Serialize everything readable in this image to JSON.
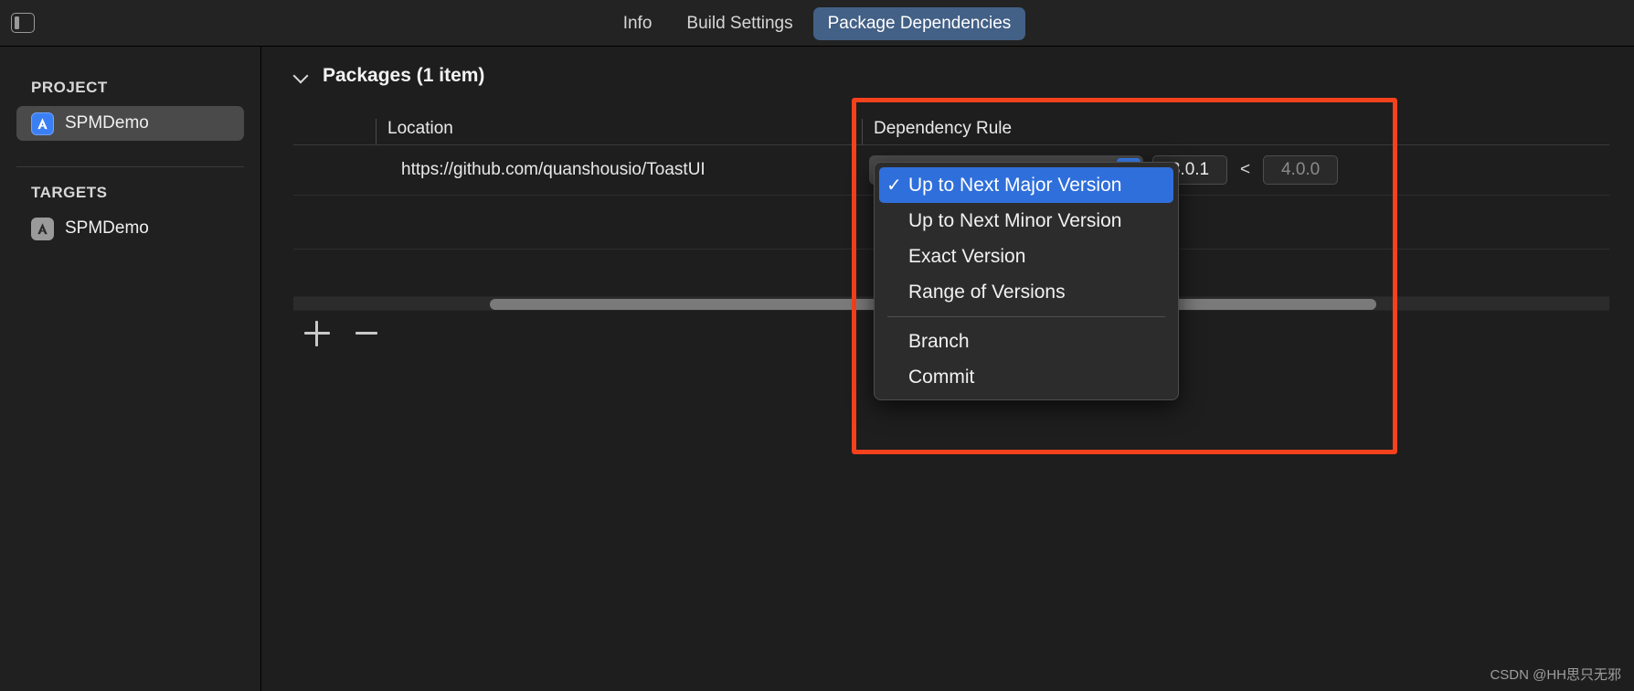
{
  "window": {
    "sidebar_toggle_icon": "sidebar-toggle-icon"
  },
  "tabs": [
    {
      "label": "Info",
      "selected": false
    },
    {
      "label": "Build Settings",
      "selected": false
    },
    {
      "label": "Package Dependencies",
      "selected": true
    }
  ],
  "sidebar": {
    "project_section": {
      "title": "PROJECT",
      "items": [
        {
          "label": "SPMDemo",
          "icon": "xcode-project-icon",
          "selected": true
        }
      ]
    },
    "targets_section": {
      "title": "TARGETS",
      "items": [
        {
          "label": "SPMDemo",
          "icon": "app-target-icon",
          "selected": false
        }
      ]
    }
  },
  "main": {
    "section": {
      "disclosure_icon": "chevron-down-icon",
      "title": "Packages (1 item)"
    },
    "table": {
      "columns": [
        {
          "label": "Location"
        },
        {
          "label": "Dependency Rule"
        }
      ],
      "rows": [
        {
          "location": "https://github.com/quanshousio/ToastUI",
          "rule_label": "Up to Next Major Version",
          "version_lower": "3.0.1",
          "comparator": "<",
          "version_upper": "4.0.0"
        }
      ]
    },
    "toolbar": {
      "add_label": "+",
      "remove_label": "−"
    }
  },
  "dropdown": {
    "items": [
      {
        "label": "Up to Next Major Version",
        "checked": true,
        "highlighted": true,
        "separator_after": false
      },
      {
        "label": "Up to Next Minor Version",
        "checked": false,
        "highlighted": false,
        "separator_after": false
      },
      {
        "label": "Exact Version",
        "checked": false,
        "highlighted": false,
        "separator_after": false
      },
      {
        "label": "Range of Versions",
        "checked": false,
        "highlighted": false,
        "separator_after": true
      },
      {
        "label": "Branch",
        "checked": false,
        "highlighted": false,
        "separator_after": false
      },
      {
        "label": "Commit",
        "checked": false,
        "highlighted": false,
        "separator_after": false
      }
    ],
    "check_glyph": "✓"
  },
  "annotation": {
    "color": "#f5411c"
  },
  "watermark": {
    "text": "CSDN @HH思只无邪"
  },
  "colors": {
    "accent_blue": "#3b7ff5",
    "menu_highlight": "#2f6fdb",
    "tab_selected": "#436086",
    "background": "#1e1e1e",
    "sidebar_background": "#202020"
  }
}
